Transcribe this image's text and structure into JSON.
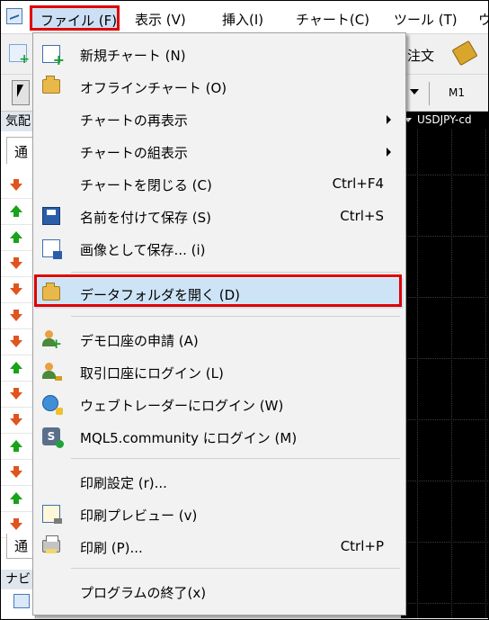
{
  "menubar": {
    "items": [
      "ファイル (F)",
      "表示 (V)",
      "挿入(I)",
      "チャート(C)",
      "ツール (T)",
      "ウ"
    ]
  },
  "toolbar": {
    "order_label": "注文",
    "timeframe_label": "M1"
  },
  "left_panel": {
    "title": "気配",
    "tab_label": "通",
    "bottom_tab_label": "通",
    "navigator_title": "ナビ",
    "rows": [
      "down",
      "up",
      "up",
      "down",
      "down",
      "down",
      "down",
      "up",
      "down",
      "down",
      "up",
      "down",
      "up",
      "down"
    ]
  },
  "chart": {
    "title": "USDJPY-cd"
  },
  "file_menu": {
    "items": [
      {
        "icon": "new-chart-icon",
        "label": "新規チャート (N)",
        "shortcut": "",
        "submenu": false
      },
      {
        "icon": "open-offline-folder-icon",
        "label": "オフラインチャート (O)",
        "shortcut": "",
        "submenu": false
      },
      {
        "icon": "",
        "label": "チャートの再表示",
        "shortcut": "",
        "submenu": true
      },
      {
        "icon": "",
        "label": "チャートの組表示",
        "shortcut": "",
        "submenu": true
      },
      {
        "icon": "",
        "label": "チャートを閉じる (C)",
        "shortcut": "Ctrl+F4",
        "submenu": false
      },
      {
        "icon": "save-icon",
        "label": "名前を付けて保存 (S)",
        "shortcut": "Ctrl+S",
        "submenu": false
      },
      {
        "icon": "save-image-icon",
        "label": "画像として保存... (i)",
        "shortcut": "",
        "submenu": false
      },
      {
        "icon": "folder-icon",
        "label": "データフォルダを開く (D)",
        "shortcut": "",
        "submenu": false,
        "highlighted": true
      },
      {
        "icon": "demo-account-icon",
        "label": "デモ口座の申請 (A)",
        "shortcut": "",
        "submenu": false
      },
      {
        "icon": "trade-account-login-icon",
        "label": "取引口座にログイン (L)",
        "shortcut": "",
        "submenu": false
      },
      {
        "icon": "web-trader-icon",
        "label": "ウェブトレーダーにログイン (W)",
        "shortcut": "",
        "submenu": false
      },
      {
        "icon": "mql5-community-icon",
        "label": "MQL5.community にログイン (M)",
        "shortcut": "",
        "submenu": false
      },
      {
        "icon": "",
        "label": "印刷設定 (r)...",
        "shortcut": "",
        "submenu": false
      },
      {
        "icon": "print-preview-icon",
        "label": "印刷プレビュー (v)",
        "shortcut": "",
        "submenu": false
      },
      {
        "icon": "printer-icon",
        "label": "印刷 (P)...",
        "shortcut": "Ctrl+P",
        "submenu": false
      },
      {
        "icon": "",
        "label": "プログラムの終了(x)",
        "shortcut": "",
        "submenu": false
      }
    ]
  },
  "colors": {
    "highlight_border": "#e00000",
    "highlight_fill": "#cde4f7",
    "chart_background": "#000000"
  }
}
